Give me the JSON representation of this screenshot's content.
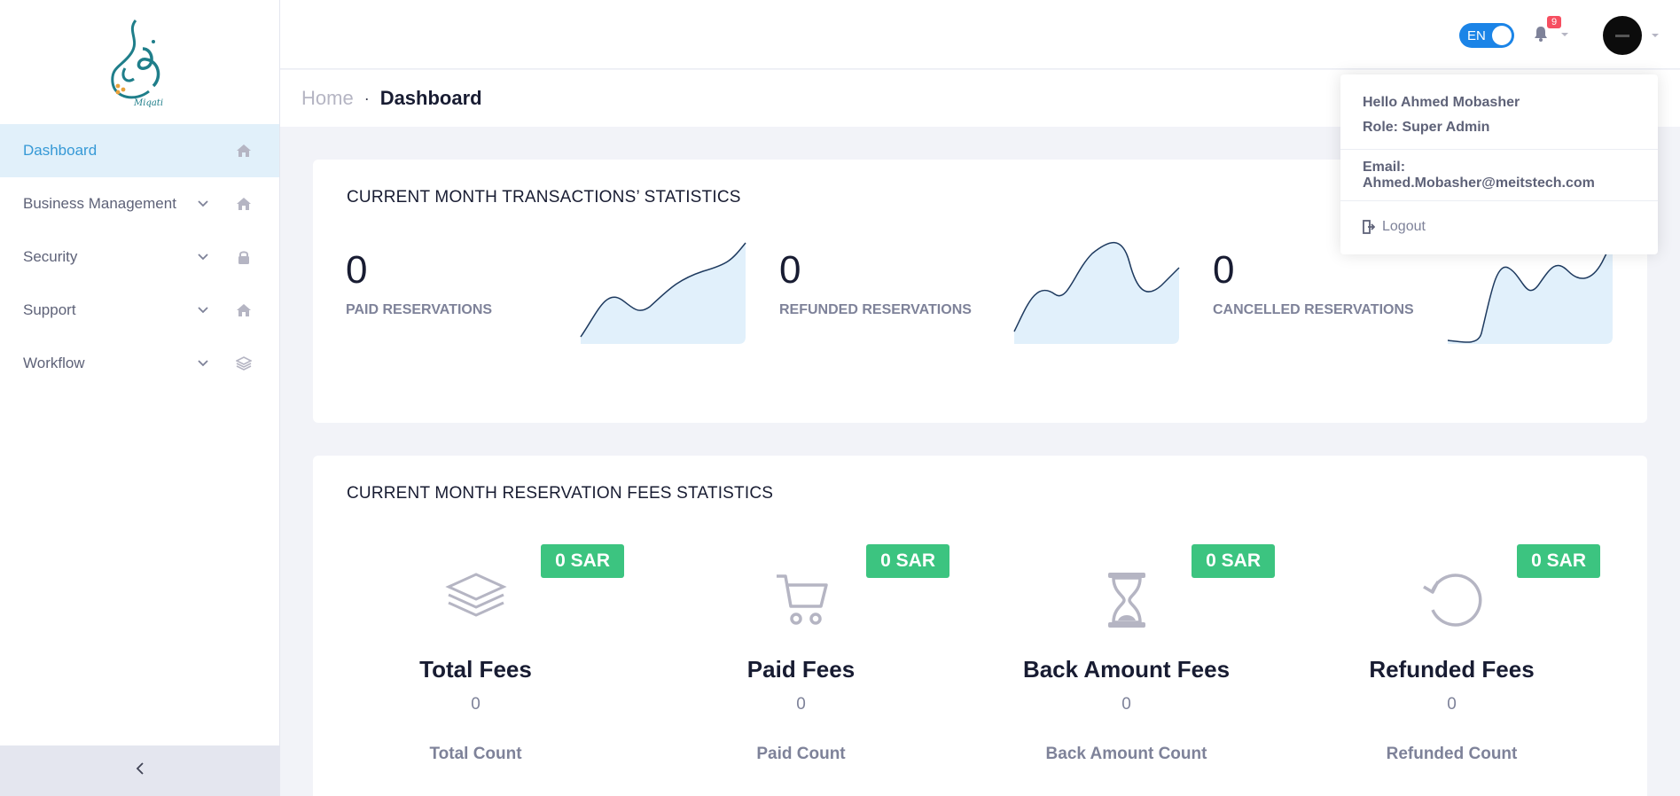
{
  "brand": {
    "logo_text": "Miqati"
  },
  "sidebar": {
    "items": [
      {
        "label": "Dashboard",
        "icon": "home-icon",
        "active": true,
        "has_chevron": false
      },
      {
        "label": "Business Management",
        "icon": "home-icon",
        "active": false,
        "has_chevron": true
      },
      {
        "label": "Security",
        "icon": "lock-icon",
        "active": false,
        "has_chevron": true
      },
      {
        "label": "Support",
        "icon": "home-icon",
        "active": false,
        "has_chevron": true
      },
      {
        "label": "Workflow",
        "icon": "layers-icon",
        "active": false,
        "has_chevron": true
      }
    ],
    "collapse_icon": "chevron-left-icon"
  },
  "topbar": {
    "language": "EN",
    "notification_count": "9"
  },
  "breadcrumb": {
    "home": "Home",
    "separator": "·",
    "current": "Dashboard"
  },
  "transactions": {
    "title": "CURRENT MONTH TRANSACTIONS’ STATISTICS",
    "stats": [
      {
        "value": "0",
        "label": "PAID RESERVATIONS"
      },
      {
        "value": "0",
        "label": "REFUNDED RESERVATIONS"
      },
      {
        "value": "0",
        "label": "CANCELLED RESERVATIONS"
      }
    ]
  },
  "fees": {
    "title": "CURRENT MONTH RESERVATION FEES STATISTICS",
    "items": [
      {
        "badge": "0 SAR",
        "icon": "layers-icon",
        "title": "Total Fees",
        "value": "0",
        "count_label": "Total Count"
      },
      {
        "badge": "0 SAR",
        "icon": "cart-icon",
        "title": "Paid Fees",
        "value": "0",
        "count_label": "Paid Count"
      },
      {
        "badge": "0 SAR",
        "icon": "hourglass-icon",
        "title": "Back Amount Fees",
        "value": "0",
        "count_label": "Back Amount Count"
      },
      {
        "badge": "0 SAR",
        "icon": "refresh-icon",
        "title": "Refunded Fees",
        "value": "0",
        "count_label": "Refunded Count"
      }
    ]
  },
  "user_menu": {
    "greeting": "Hello Ahmed Mobasher",
    "role": "Role: Super Admin",
    "email": "Email: Ahmed.Mobasher@meitstech.com",
    "logout": "Logout"
  },
  "colors": {
    "accent": "#3699d6",
    "toggle": "#1b84e7",
    "badge_green": "#3cc480",
    "notification_red": "#f64e60",
    "spark_line": "#1e3a5f",
    "spark_fill": "#e1f0fb"
  }
}
